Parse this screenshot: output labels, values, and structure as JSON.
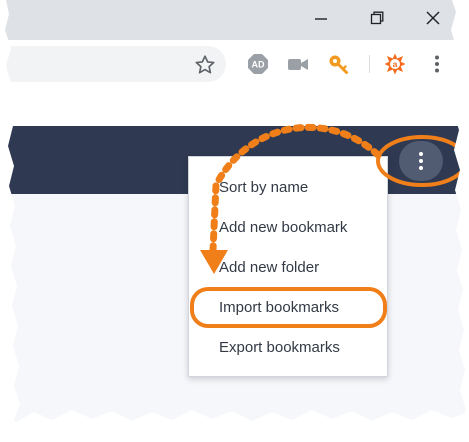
{
  "window": {
    "controls": [
      "minimize-icon",
      "maximize-icon",
      "close-icon"
    ]
  },
  "toolbar": {
    "extensions": [
      {
        "name": "adblock-extension",
        "badge": "AD"
      },
      {
        "name": "video-extension"
      },
      {
        "name": "password-key-extension"
      },
      {
        "name": "avast-extension",
        "badge": "a"
      }
    ]
  },
  "menu": {
    "items": [
      {
        "label": "Sort by name"
      },
      {
        "label": "Add new bookmark"
      },
      {
        "label": "Add new folder"
      },
      {
        "label": "Import bookmarks"
      },
      {
        "label": "Export bookmarks"
      }
    ],
    "highlighted_index": 3
  },
  "colors": {
    "title_bar": "#dee1e6",
    "header_bar": "#2f3a52",
    "menu_button": "#515b71",
    "annotation_orange": "#f07f1a",
    "menu_text": "#333a45"
  }
}
